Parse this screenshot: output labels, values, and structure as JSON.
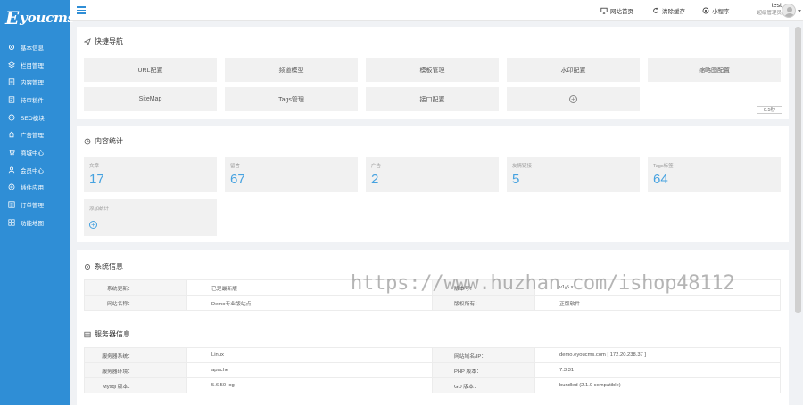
{
  "app": {
    "logo_letter": "E",
    "logo_text": "youcms"
  },
  "sidebar": {
    "items": [
      {
        "label": "基本信息",
        "icon": "gear-icon"
      },
      {
        "label": "栏目管理",
        "icon": "layers-icon"
      },
      {
        "label": "内容管理",
        "icon": "document-icon"
      },
      {
        "label": "待审稿件",
        "icon": "review-icon"
      },
      {
        "label": "SEO模块",
        "icon": "seo-icon"
      },
      {
        "label": "广告管理",
        "icon": "home-icon"
      },
      {
        "label": "商城中心",
        "icon": "cart-icon"
      },
      {
        "label": "会员中心",
        "icon": "user-icon"
      },
      {
        "label": "插件应用",
        "icon": "plugin-icon"
      },
      {
        "label": "订单管理",
        "icon": "list-icon"
      },
      {
        "label": "功能地图",
        "icon": "grid-icon"
      }
    ]
  },
  "topbar": {
    "site_home": "网站首页",
    "clear_cache": "清除缓存",
    "mini_program": "小程序",
    "username": "test",
    "role": "超级管理员"
  },
  "quick_nav": {
    "title": "快捷导航",
    "items": [
      "URL配置",
      "频道模型",
      "模板管理",
      "水印配置",
      "缩略图配置",
      "SiteMap",
      "Tags管理",
      "接口配置"
    ],
    "add_symbol": "+",
    "speed_label": "0.5秒"
  },
  "content_stats": {
    "title": "内容统计",
    "items": [
      {
        "label": "文章",
        "value": "17"
      },
      {
        "label": "留言",
        "value": "67"
      },
      {
        "label": "广告",
        "value": "2"
      },
      {
        "label": "友情链接",
        "value": "5"
      },
      {
        "label": "Tags标签",
        "value": "64"
      }
    ],
    "add_label": "添加统计",
    "add_symbol": "+"
  },
  "system_info": {
    "title": "系统信息",
    "rows": [
      {
        "k1": "系统更新：",
        "v1": "已是最新版",
        "k2": "版本号：",
        "v2": "v1.5.x"
      },
      {
        "k1": "网站名称：",
        "v1": "Demo专业版站点",
        "k2": "版权所有：",
        "v2": "正版软件"
      }
    ]
  },
  "server_info": {
    "title": "服务器信息",
    "rows": [
      {
        "k1": "服务器系统：",
        "v1": "Linux",
        "k2": "网站域名/IP：",
        "v2": "demo.eyoucms.com [ 172.20.238.37 ]"
      },
      {
        "k1": "服务器环境：",
        "v1": "apache",
        "k2": "PHP 版本：",
        "v2": "7.3.31"
      },
      {
        "k1": "Mysql 版本：",
        "v1": "5.6.50-log",
        "k2": "GD 版本：",
        "v2": "bundled (2.1.0 compatible)"
      }
    ]
  },
  "watermark": "https://www.huzhan.com/ishop48112",
  "colors": {
    "sidebar": "#2f8ed6",
    "accent": "#46a2e0",
    "panel_bg": "#ffffff",
    "page_bg": "#f0f2f5"
  }
}
